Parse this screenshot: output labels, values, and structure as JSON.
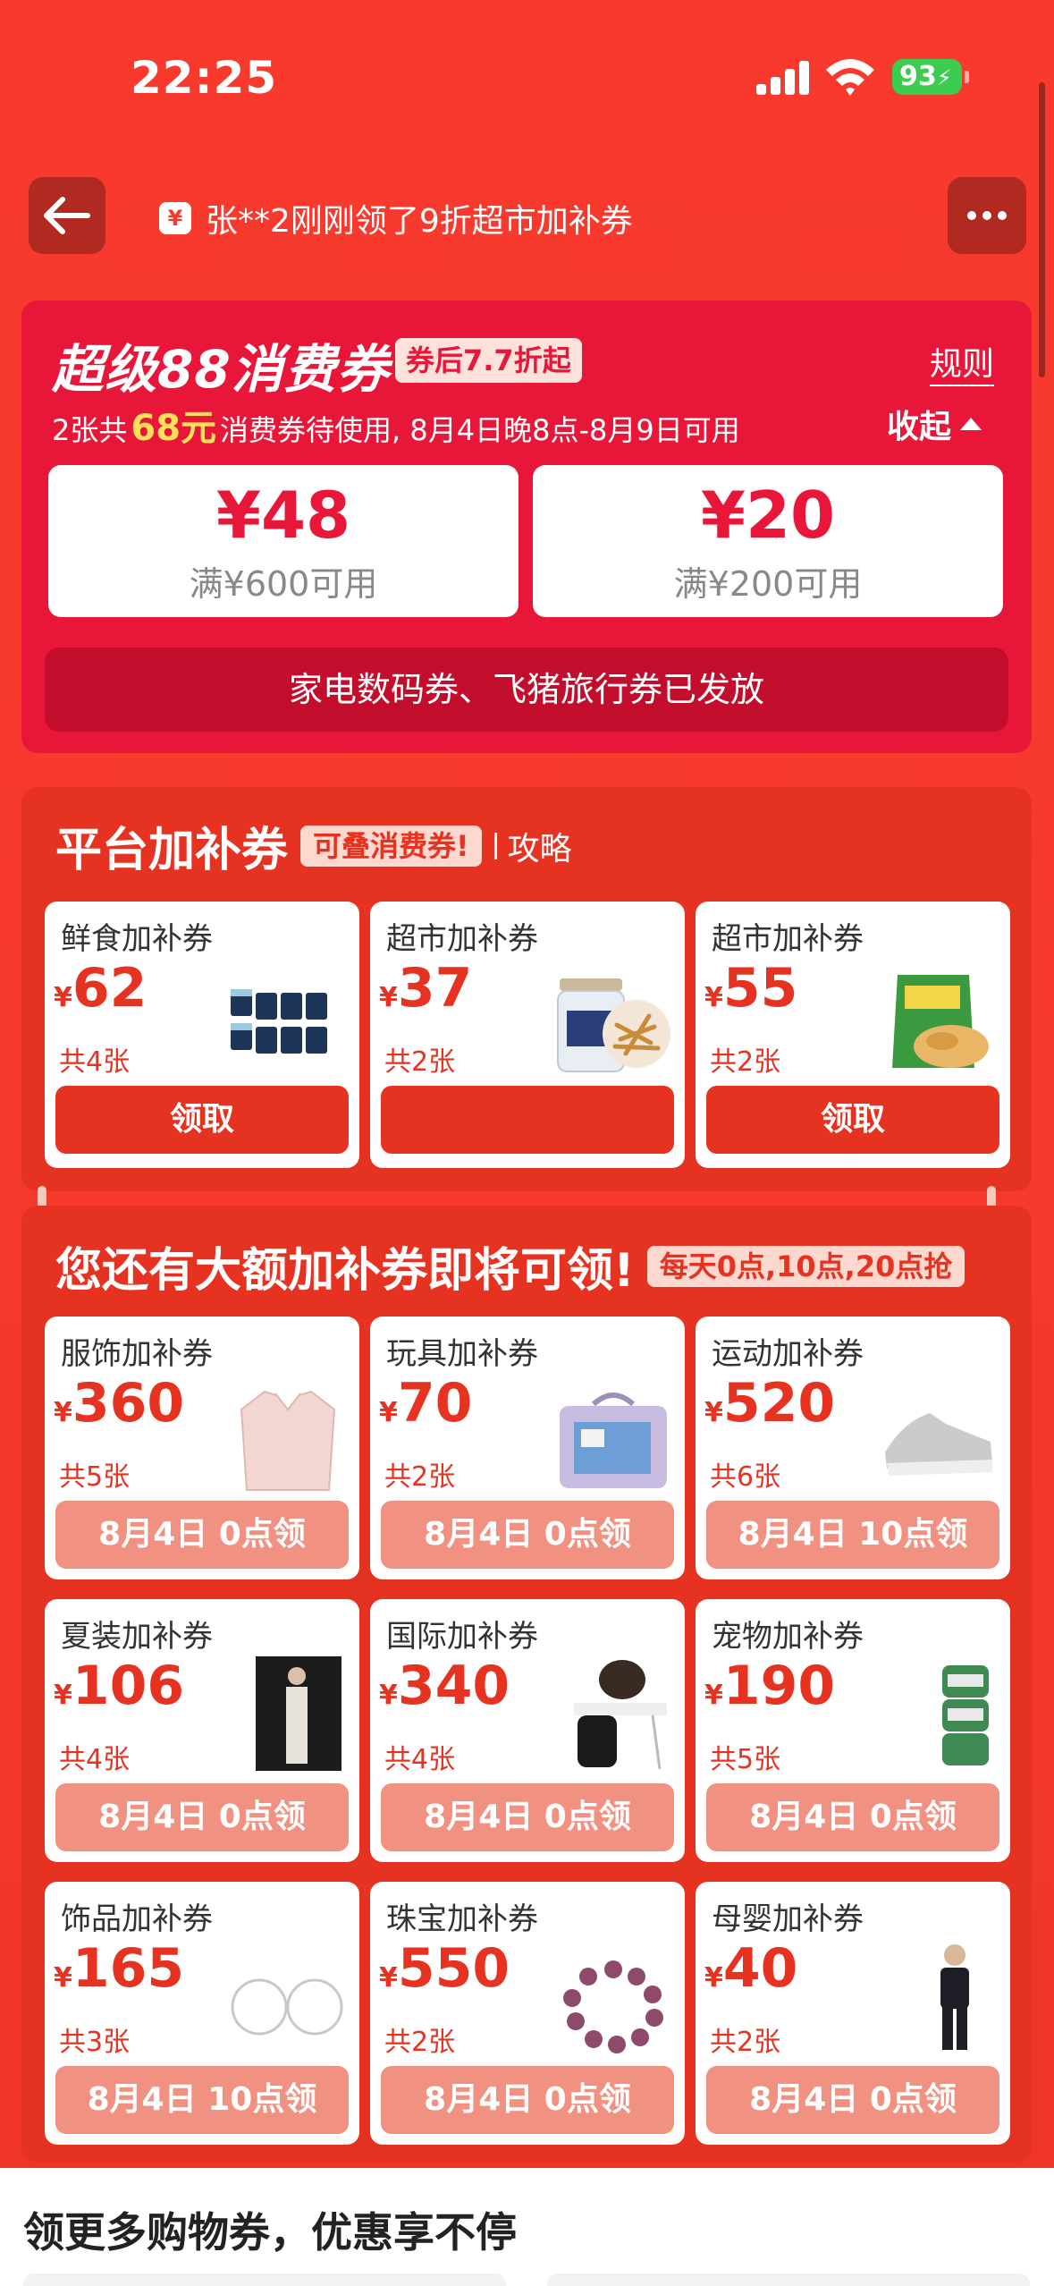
{
  "status": {
    "time": "22:25",
    "battery": "93"
  },
  "nav": {
    "ticker_icon": "¥",
    "ticker": "张**2刚刚领了9折超市加补券"
  },
  "super": {
    "title": "超级88消费券",
    "tag": "券后7.7折起",
    "rules": "规则",
    "sub_before": "2张共",
    "sub_amount": "68元",
    "sub_after": "消费券待使用, 8月4日晚8点-8月9日可用",
    "collapse": "收起",
    "coupons": [
      {
        "value": "¥48",
        "condition": "满¥600可用"
      },
      {
        "value": "¥20",
        "condition": "满¥200可用"
      }
    ],
    "issued": "家电数码券、飞猪旅行券已发放"
  },
  "platform": {
    "title": "平台加补券",
    "tag": "可叠消费券!",
    "strategy": "攻略",
    "tiles": [
      {
        "name": "鲜食加补券",
        "currency": "¥",
        "value": "62",
        "count": "共4张",
        "button": "领取",
        "image": "yogurt-cups-image"
      },
      {
        "name": "超市加补券",
        "currency": "¥",
        "value": "37",
        "count": "共2张",
        "button": "",
        "image": "cordyceps-jar-image"
      },
      {
        "name": "超市加补券",
        "currency": "¥",
        "value": "55",
        "count": "共2张",
        "button": "领取",
        "image": "snack-bag-image"
      }
    ]
  },
  "big": {
    "title": "您还有大额加补券即将可领!",
    "tag": "每天0点,10点,20点抢",
    "tiles": [
      {
        "name": "服饰加补券",
        "currency": "¥",
        "value": "360",
        "count": "共5张",
        "button": "8月4日 0点领"
      },
      {
        "name": "玩具加补券",
        "currency": "¥",
        "value": "70",
        "count": "共2张",
        "button": "8月4日 0点领"
      },
      {
        "name": "运动加补券",
        "currency": "¥",
        "value": "520",
        "count": "共6张",
        "button": "8月4日 10点领"
      },
      {
        "name": "夏装加补券",
        "currency": "¥",
        "value": "106",
        "count": "共4张",
        "button": "8月4日 0点领"
      },
      {
        "name": "国际加补券",
        "currency": "¥",
        "value": "340",
        "count": "共4张",
        "button": "8月4日 0点领"
      },
      {
        "name": "宠物加补券",
        "currency": "¥",
        "value": "190",
        "count": "共5张",
        "button": "8月4日 0点领"
      },
      {
        "name": "饰品加补券",
        "currency": "¥",
        "value": "165",
        "count": "共3张",
        "button": "8月4日 10点领"
      },
      {
        "name": "珠宝加补券",
        "currency": "¥",
        "value": "550",
        "count": "共2张",
        "button": "8月4日 0点领"
      },
      {
        "name": "母婴加补券",
        "currency": "¥",
        "value": "40",
        "count": "共2张",
        "button": "8月4日 0点领"
      }
    ]
  },
  "bottom": {
    "title": "领更多购物券，优惠享不停"
  },
  "colors": {
    "bg": "#f5392c",
    "super_card": "#e8173a",
    "coupon_red": "#e63321",
    "pending_button": "#f19181"
  }
}
